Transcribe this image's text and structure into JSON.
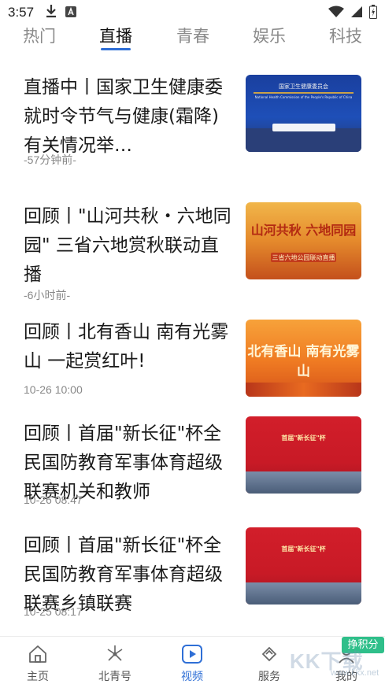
{
  "status_bar": {
    "time": "3:57",
    "icons_left": [
      "download-icon",
      "app-notification-icon"
    ],
    "icons_right": [
      "wifi-icon",
      "cellular-signal-icon",
      "battery-icon"
    ]
  },
  "tabs": [
    {
      "label": "热门",
      "active": false
    },
    {
      "label": "直播",
      "active": true
    },
    {
      "label": "青春",
      "active": false
    },
    {
      "label": "娱乐",
      "active": false
    },
    {
      "label": "科技",
      "active": false
    }
  ],
  "news": [
    {
      "title": "直播中丨国家卫生健康委就时令节气与健康(霜降)有关情况举…",
      "time": "-57分钟前-",
      "thumb_text": "国家卫生健康委员会",
      "thumb_subtext": "National Health Commission of the People's Republic of China"
    },
    {
      "title": "回顾丨\"山河共秋・六地同园\" 三省六地赏秋联动直播",
      "time": "-6小时前-",
      "thumb_text": "山河共秋 六地同园",
      "thumb_subtext": "三省六地公园联动直播"
    },
    {
      "title": "回顾丨北有香山 南有光雾山 一起赏红叶!",
      "time": "10-26 10:00",
      "thumb_text": "北有香山 南有光雾山",
      "thumb_subtext": ""
    },
    {
      "title": "回顾丨首届\"新长征\"杯全民国防教育军事体育超级联赛机关和教师",
      "time": "10-26 08:47",
      "thumb_text": "首届\"新长征\"杯",
      "thumb_subtext": ""
    },
    {
      "title": "回顾丨首届\"新长征\"杯全民国防教育军事体育超级联赛乡镇联赛",
      "time": "10-25 08:17",
      "thumb_text": "首届\"新长征\"杯",
      "thumb_subtext": ""
    }
  ],
  "bottom_nav": [
    {
      "label": "主页",
      "icon": "home-icon",
      "active": false
    },
    {
      "label": "北青号",
      "icon": "flower-icon",
      "active": false
    },
    {
      "label": "视频",
      "icon": "video-play-icon",
      "active": true
    },
    {
      "label": "服务",
      "icon": "service-icon",
      "active": false
    },
    {
      "label": "我的",
      "icon": "profile-icon",
      "active": false
    }
  ],
  "points_badge": "挣积分",
  "watermark": "KK下载",
  "watermark_sub": "www.kkx.net",
  "colors": {
    "accent": "#2f6fd6",
    "badge": "#2fbf8a"
  }
}
